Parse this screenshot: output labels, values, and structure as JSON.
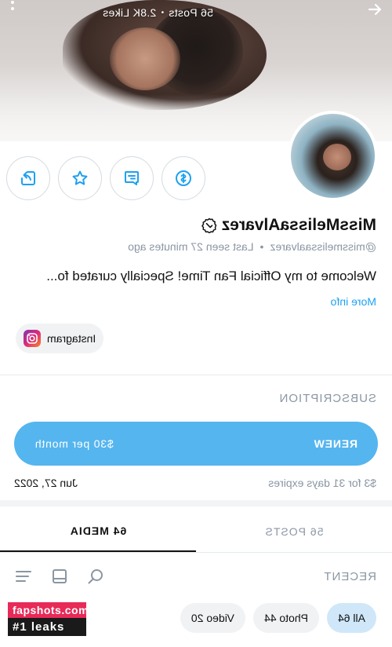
{
  "cover": {
    "posts_stat": "56 Posts",
    "likes_stat": "2.8K Likes",
    "separator": "•"
  },
  "profile": {
    "name": "MissMelissaAlvarez",
    "username": "@missmelissaalvarez",
    "separator": "•",
    "last_seen": "Last seen 27 minutes ago",
    "bio": "Welcome to my Official Fan Time! Specially curated fo...",
    "more_info": "More info",
    "instagram_label": "Instagram"
  },
  "subscription": {
    "title": "SUBSCRIPTION",
    "renew_label": "RENEW",
    "price": "$30 per month",
    "expire_text": "$3 for 31 days expires",
    "expire_date": "Jun 27, 2022"
  },
  "tabs": [
    {
      "label": "56 POSTS",
      "active": false
    },
    {
      "label": "64 MEDIA",
      "active": true
    }
  ],
  "media": {
    "recent_label": "RECENT",
    "filters": [
      {
        "label": "All 64",
        "active": true
      },
      {
        "label": "Photo 44",
        "active": false
      },
      {
        "label": "Video 20",
        "active": false
      }
    ]
  },
  "watermark": {
    "line1": "fapshots.com",
    "line2": "#1 leaks"
  },
  "colors": {
    "accent": "#55b5ef",
    "link": "#1da1f2",
    "muted": "#8a96a3",
    "pill_active": "#cfe7f9"
  },
  "icons": {
    "actions": [
      "dollar-tip-icon",
      "message-icon",
      "star-icon",
      "share-icon"
    ],
    "tools": [
      "search-icon",
      "grid-view-icon",
      "sort-icon"
    ]
  }
}
